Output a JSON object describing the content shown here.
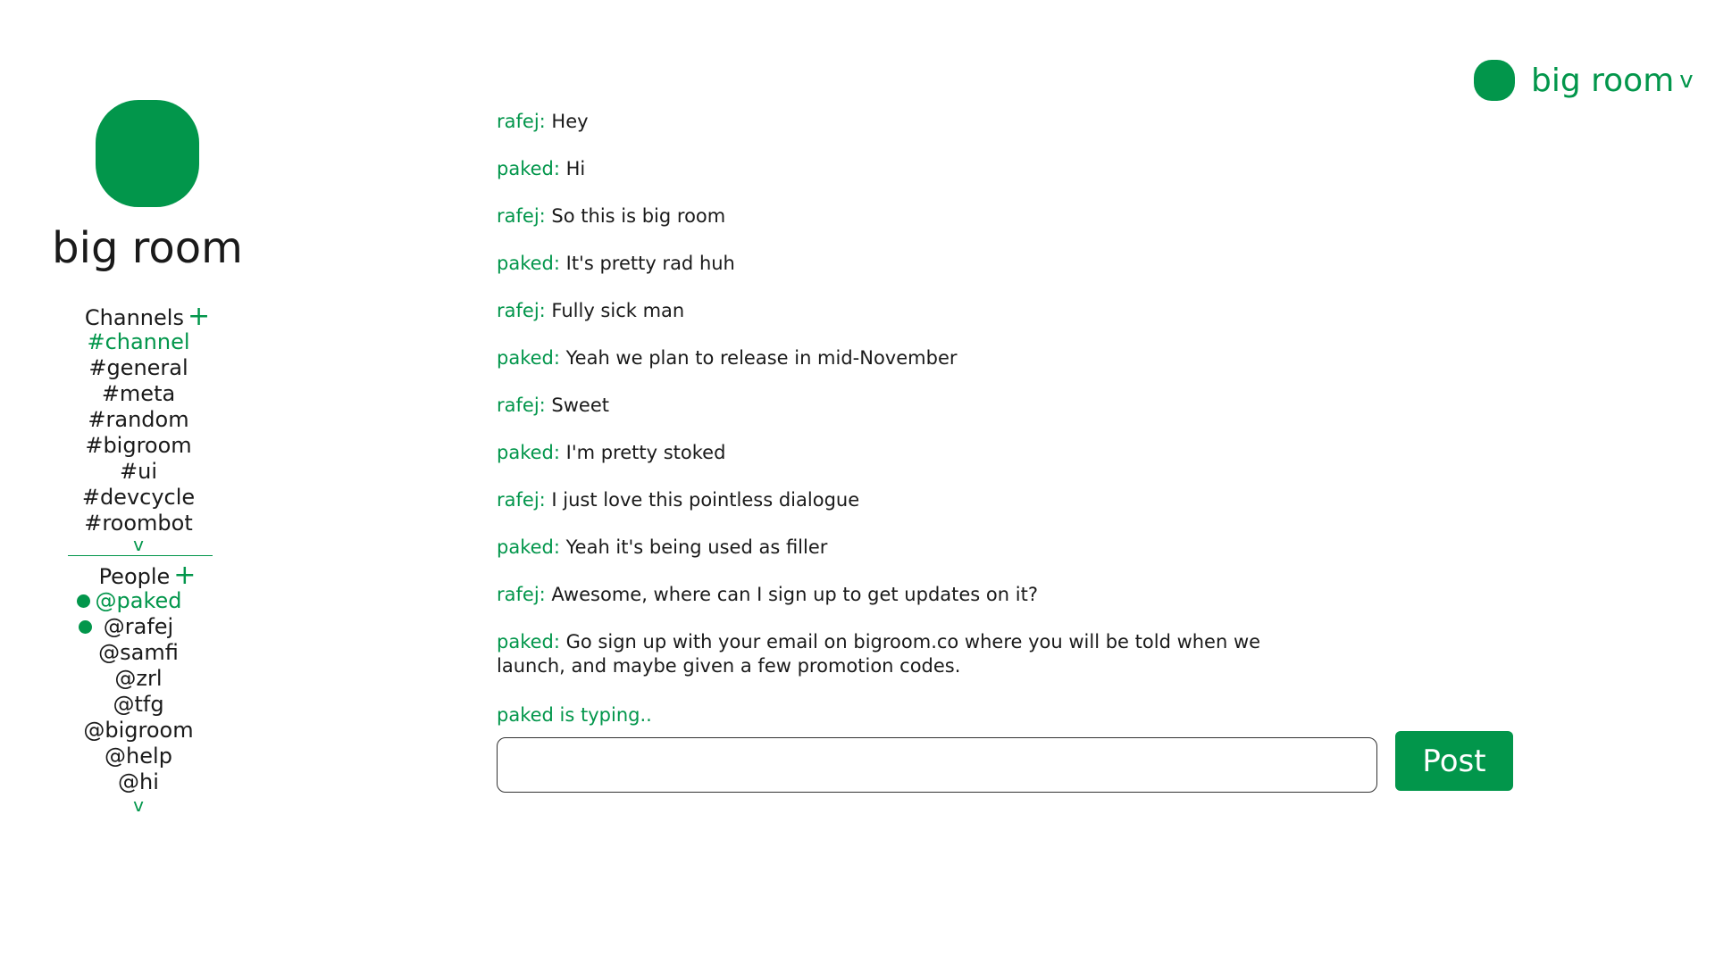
{
  "room": {
    "name": "big room"
  },
  "switcher": {
    "label": "big room",
    "caret": "v"
  },
  "channels": {
    "header": "Channels",
    "add": "+",
    "items": [
      "#channel",
      "#general",
      "#meta",
      "#random",
      "#bigroom",
      "#ui",
      "#devcycle",
      "#roombot"
    ],
    "active": "#channel",
    "more": "v"
  },
  "people": {
    "header": "People",
    "add": "+",
    "items": [
      "@paked",
      "@rafej",
      "@samfi",
      "@zrl",
      "@tfg",
      "@bigroom",
      "@help",
      "@hi"
    ],
    "online": [
      "@paked",
      "@rafej"
    ],
    "active": "@paked",
    "more": "v"
  },
  "messages": [
    {
      "author": "rafej:",
      "text": "Hey"
    },
    {
      "author": "paked:",
      "text": "Hi"
    },
    {
      "author": "rafej:",
      "text": "So this is big room"
    },
    {
      "author": "paked:",
      "text": "It's pretty rad huh"
    },
    {
      "author": "rafej:",
      "text": "Fully sick man"
    },
    {
      "author": "paked:",
      "text": "Yeah we plan to release in mid-November"
    },
    {
      "author": "rafej:",
      "text": "Sweet"
    },
    {
      "author": "paked:",
      "text": "I'm pretty stoked"
    },
    {
      "author": "rafej:",
      "text": "I just love this pointless dialogue"
    },
    {
      "author": "paked:",
      "text": "Yeah it's being used as filler"
    },
    {
      "author": "rafej:",
      "text": "Awesome, where can I sign up to get updates on it?"
    },
    {
      "author": "paked:",
      "text": "Go sign up with your email on bigroom.co where you will be told when we launch, and maybe given a few promotion codes."
    }
  ],
  "typing_indicator": "paked is typing..",
  "composer": {
    "value": "",
    "placeholder": "",
    "post_label": "Post"
  },
  "colors": {
    "accent": "#02964b",
    "text": "#1a1a1a",
    "background": "#ffffff"
  }
}
